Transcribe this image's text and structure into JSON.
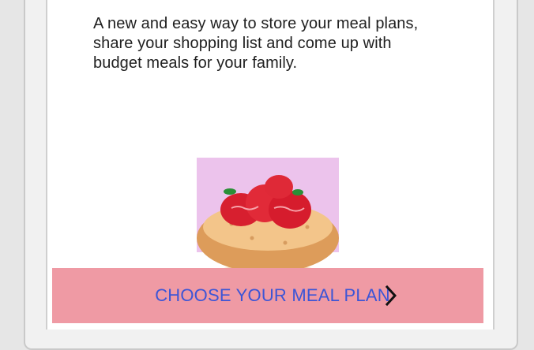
{
  "intro": {
    "text": "A new and easy way to store your meal plans, share your shopping list and come up with budget meals for your family."
  },
  "cta": {
    "label": "CHOOSE YOUR MEAL PLAN",
    "icon": "chevron-right-icon"
  },
  "colors": {
    "cta_background": "#ef9aa4",
    "cta_text": "#3c55d6",
    "photo_background": "#ecc3ec"
  }
}
